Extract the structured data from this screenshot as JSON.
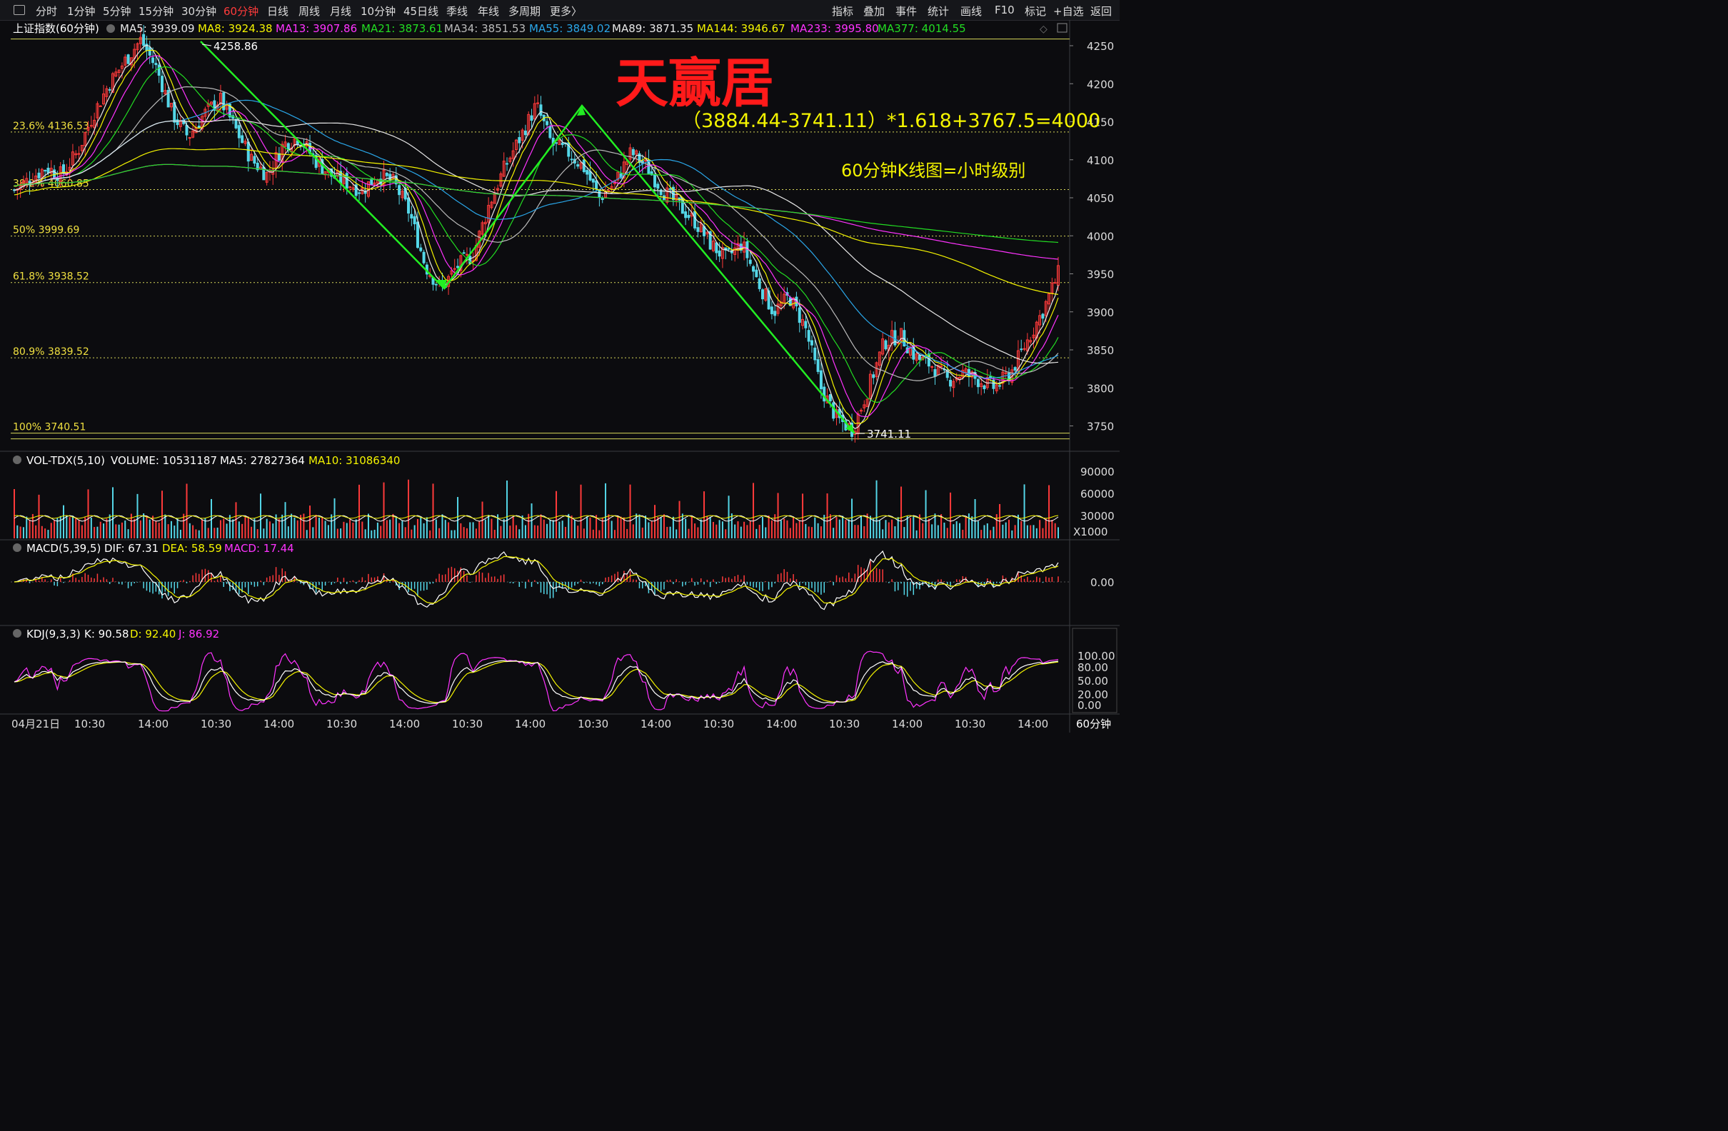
{
  "toolbar": {
    "periods": [
      "分时",
      "1分钟",
      "5分钟",
      "15分钟",
      "30分钟",
      "60分钟",
      "日线",
      "周线",
      "月线",
      "10分钟",
      "45日线",
      "季线",
      "年线",
      "多周期",
      "更多〉"
    ],
    "active_period": "60分钟",
    "right_buttons": [
      "指标",
      "叠加",
      "事件",
      "统计",
      "画线",
      "F10",
      "标记",
      "+自选",
      "返回"
    ]
  },
  "main_panel": {
    "title": "上证指数(60分钟)",
    "ma_legend": [
      {
        "label": "MA5: 3939.09",
        "color": "#e8e8e8"
      },
      {
        "label": "MA8: 3924.38",
        "color": "#f4f400"
      },
      {
        "label": "MA13: 3907.86",
        "color": "#ff33ff"
      },
      {
        "label": "MA21: 3873.61",
        "color": "#22dd22"
      },
      {
        "label": "MA34: 3851.53",
        "color": "#bbbbbb"
      },
      {
        "label": "MA55: 3849.02",
        "color": "#2aa6e8"
      },
      {
        "label": "MA89: 3871.35",
        "color": "#e8e8e8"
      },
      {
        "label": "MA144: 3946.67",
        "color": "#f4f400"
      },
      {
        "label": "MA233: 3995.80",
        "color": "#ff33ff"
      },
      {
        "label": "MA377: 4014.55",
        "color": "#22dd22"
      }
    ],
    "watermark": "天赢居",
    "formula": "（3884.44-3741.11）*1.618+3767.5=4000",
    "note": "60分钟K线图=小时级别",
    "high_label": "4258.86",
    "low_label": "3741.11"
  },
  "chart_data": {
    "type": "candlestick",
    "title": "上证指数(60分钟)",
    "y_ticks": [
      4250,
      4200,
      4150,
      4100,
      4050,
      4000,
      3950,
      3900,
      3850,
      3800,
      3750
    ],
    "ylim": [
      3725,
      4275
    ],
    "x_ticks": [
      "04月21日",
      "10:30",
      "14:00",
      "10:30",
      "14:00",
      "10:30",
      "14:00",
      "10:30",
      "14:00",
      "10:30",
      "14:00",
      "10:30",
      "14:00",
      "10:30",
      "14:00",
      "10:30",
      "14:00"
    ],
    "fib_levels": [
      {
        "label": "23.6% 4136.53",
        "value": 4136.53
      },
      {
        "label": "38.2% 4060.85",
        "value": 4060.85
      },
      {
        "label": "50% 3999.69",
        "value": 3999.69
      },
      {
        "label": "61.8% 3938.52",
        "value": 3938.52
      },
      {
        "label": "80.9% 3839.52",
        "value": 3839.52
      },
      {
        "label": "100% 3740.51",
        "value": 3740.51
      }
    ],
    "top_level": 4258.86,
    "zigzag": [
      {
        "bar": 60,
        "value": 4258.86
      },
      {
        "bar": 134,
        "value": 3930
      },
      {
        "bar": 180,
        "value": 4172
      },
      {
        "bar": 270,
        "value": 3741.11
      }
    ],
    "price_path": [
      4060,
      4075,
      4090,
      4080,
      4110,
      4160,
      4200,
      4230,
      4258,
      4220,
      4160,
      4130,
      4160,
      4180,
      4140,
      4100,
      4080,
      4120,
      4130,
      4100,
      4080,
      4070,
      4060,
      4080,
      4070,
      4030,
      3960,
      3930,
      3960,
      3975,
      4040,
      4090,
      4130,
      4172,
      4120,
      4110,
      4090,
      4050,
      4070,
      4110,
      4090,
      4060,
      4040,
      4020,
      3990,
      3970,
      3990,
      3940,
      3900,
      3920,
      3880,
      3800,
      3760,
      3745,
      3800,
      3860,
      3870,
      3840,
      3830,
      3810,
      3820,
      3810,
      3800,
      3820,
      3860,
      3900,
      3950
    ],
    "indicators": {
      "volume": {
        "title": "VOL-TDX(5,10)",
        "volume": "VOLUME: 10531187",
        "ma5": "MA5: 27827364",
        "ma10": "MA10: 31086340",
        "y_ticks": [
          "90000",
          "60000",
          "30000"
        ],
        "unit": "X1000"
      },
      "macd": {
        "title": "MACD(5,39,5)",
        "dif": "DIF: 67.31",
        "dea": "DEA: 58.59",
        "macd": "MACD: 17.44",
        "y_ticks": [
          "0.00"
        ]
      },
      "kdj": {
        "title": "KDJ(9,3,3)",
        "k": "K: 90.58",
        "d": "D: 92.40",
        "j": "J: 86.92",
        "y_ticks": [
          "100.00",
          "80.00",
          "50.00",
          "20.00",
          "0.00"
        ]
      }
    },
    "period_label": "60分钟"
  }
}
